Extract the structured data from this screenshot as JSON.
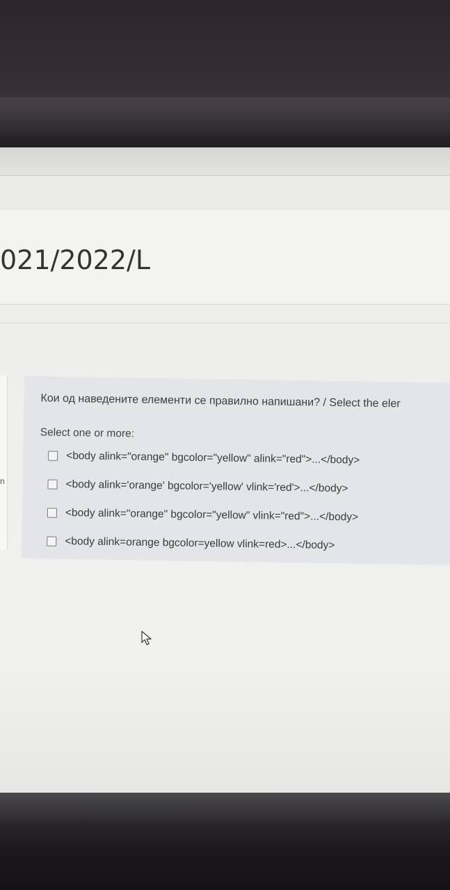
{
  "course": {
    "title": "021/2022/L"
  },
  "sidebar": {
    "fragment": "n"
  },
  "question": {
    "text": "Кои од наведените елементи се правилно напишани? / Select the eler",
    "prompt": "Select one or more:",
    "options": [
      {
        "label": "<body alink=\"orange\" bgcolor=\"yellow\" alink=\"red\">...</body>",
        "checked": false
      },
      {
        "label": "<body alink='orange' bgcolor='yellow' vlink='red'>...</body>",
        "checked": false
      },
      {
        "label": "<body alink=\"orange\" bgcolor=\"yellow\" vlink=\"red\">...</body>",
        "checked": false
      },
      {
        "label": "<body alink=orange bgcolor=yellow vlink=red>...</body>",
        "checked": false
      }
    ]
  },
  "icons": {
    "cursor": "mouse-pointer-icon"
  },
  "colors": {
    "panel": "#e3e5e8",
    "page": "#f0f0ee",
    "text": "#3d3d3d"
  }
}
